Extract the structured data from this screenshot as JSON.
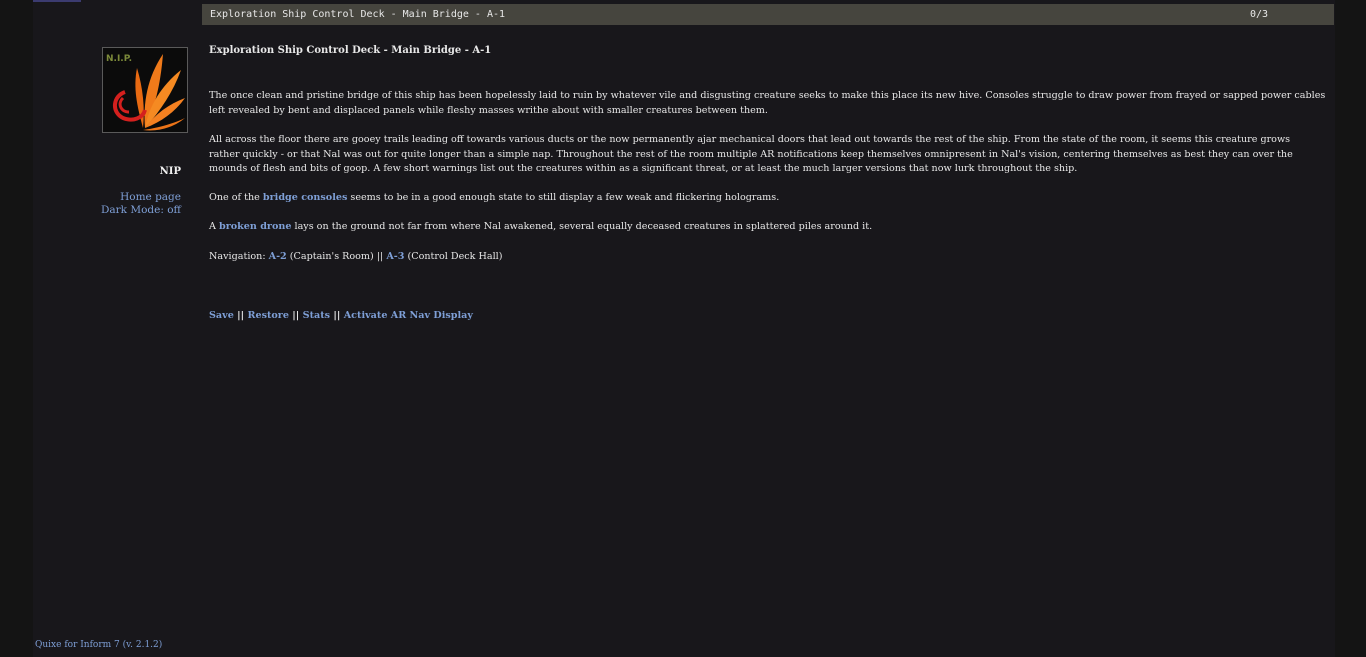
{
  "status_bar": {
    "location": "Exploration Ship Control Deck - Main Bridge - A-1",
    "score": "0/3"
  },
  "sidebar": {
    "logo_text": "N.I.P.",
    "game_name": "NIP",
    "home_link": "Home page",
    "dark_mode_link": "Dark Mode: off"
  },
  "main": {
    "room_title": "Exploration Ship Control Deck - Main Bridge - A-1",
    "paragraph_1": "The once clean and pristine bridge of this ship has been hopelessly laid to ruin by whatever vile and disgusting creature seeks to make this place its new hive. Consoles struggle to draw power from frayed or sapped power cables left revealed by bent and displaced panels while fleshy masses writhe about with smaller creatures between them.",
    "paragraph_2": "All across the floor there are gooey trails leading off towards various ducts or the now permanently ajar mechanical doors that lead out towards the rest of the ship. From the state of the room, it seems this creature grows rather quickly - or that Nal was out for quite longer than a simple nap. Throughout the rest of the room multiple AR notifications keep themselves omnipresent in Nal's vision, centering themselves as best they can over the mounds of flesh and bits of goop. A few short warnings list out the creatures within as a significant threat, or at least the much larger versions that now lurk throughout the ship.",
    "consoles": {
      "prefix": "One of the ",
      "link": "bridge consoles",
      "suffix": " seems to be in a good enough state to still display a few weak and flickering holograms."
    },
    "drone": {
      "prefix": "A ",
      "link": "broken drone",
      "suffix": " lays on the ground not far from where Nal awakened, several equally deceased creatures in splattered piles around it."
    },
    "navigation": {
      "label": "Navigation: ",
      "link_a2": "A-2",
      "a2_desc": " (Captain's Room) || ",
      "link_a3": "A-3",
      "a3_desc": " (Control Deck Hall)"
    },
    "commands": {
      "save": "Save",
      "restore": "Restore",
      "stats": "Stats",
      "ar_nav": "Activate AR Nav Display",
      "separator": " || "
    }
  },
  "footer": {
    "credit": "Quixe for Inform 7 (v. 2.1.2)"
  },
  "colors": {
    "background": "#141414",
    "page": "#18171b",
    "status_bar": "#46453e",
    "link": "#7e9fd6",
    "text": "#e8e8e8",
    "logo_orange": "#f07a1a",
    "logo_red": "#d4201e"
  }
}
